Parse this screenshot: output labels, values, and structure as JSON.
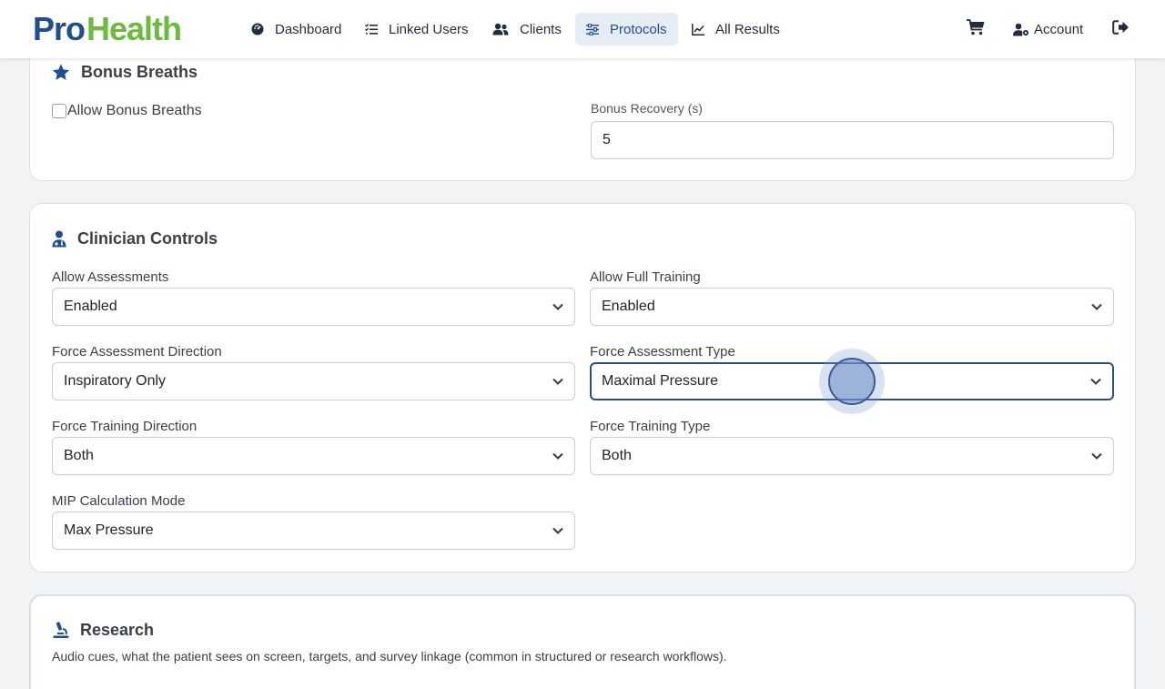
{
  "logo": {
    "part1": "Pro",
    "part2": "Health"
  },
  "nav": {
    "items": [
      {
        "label": "Dashboard",
        "icon": "gauge-icon"
      },
      {
        "label": "Linked Users",
        "icon": "list-check-icon"
      },
      {
        "label": "Clients",
        "icon": "users-icon"
      },
      {
        "label": "Protocols",
        "icon": "sliders-icon",
        "active": true
      },
      {
        "label": "All Results",
        "icon": "line-chart-icon"
      }
    ],
    "cart_icon": "cart-icon",
    "account_label": "Account",
    "logout_icon": "logout-icon"
  },
  "bonus": {
    "title": "Bonus Breaths",
    "allow_label": "Allow Bonus Breaths",
    "allow_checked": false,
    "recovery_label": "Bonus Recovery (s)",
    "recovery_value": "5"
  },
  "clinician": {
    "title": "Clinician Controls",
    "fields": {
      "allow_assessments": {
        "label": "Allow Assessments",
        "value": "Enabled"
      },
      "allow_full_training": {
        "label": "Allow Full Training",
        "value": "Enabled"
      },
      "force_assessment_direction": {
        "label": "Force Assessment Direction",
        "value": "Inspiratory Only"
      },
      "force_assessment_type": {
        "label": "Force Assessment Type",
        "value": "Maximal Pressure"
      },
      "force_training_direction": {
        "label": "Force Training Direction",
        "value": "Both"
      },
      "force_training_type": {
        "label": "Force Training Type",
        "value": "Both"
      },
      "mip_calculation_mode": {
        "label": "MIP Calculation Mode",
        "value": "Max Pressure"
      }
    }
  },
  "research": {
    "title": "Research",
    "description": "Audio cues, what the patient sees on screen, targets, and survey linkage (common in structured or research workflows)."
  },
  "colors": {
    "brand_blue": "#1f4f8f",
    "brand_green": "#6dba3f",
    "focus_border": "#2d4e7f"
  }
}
